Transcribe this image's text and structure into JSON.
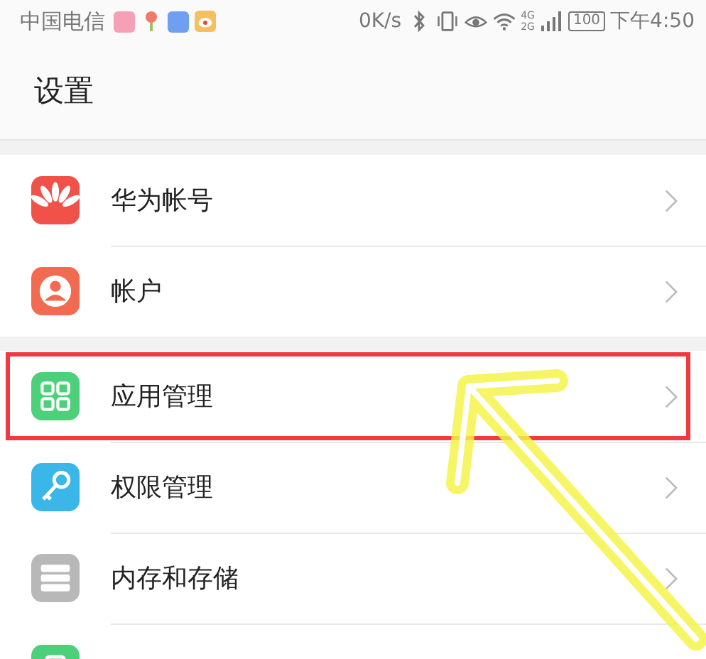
{
  "status_bar": {
    "carrier": "中国电信",
    "speed": "0K/s",
    "network_labels": [
      "4G",
      "2G"
    ],
    "battery": "100",
    "time": "下午4:50"
  },
  "title": "设置",
  "sections": [
    {
      "items": [
        {
          "label": "华为帐号",
          "color": "#f0524a",
          "highlighted": false
        },
        {
          "label": "帐户",
          "color": "#f26a4f",
          "highlighted": false
        }
      ]
    },
    {
      "items": [
        {
          "label": "应用管理",
          "color": "#4cd07a",
          "highlighted": true
        },
        {
          "label": "权限管理",
          "color": "#3bb6e8",
          "highlighted": false
        },
        {
          "label": "内存和存储",
          "color": "#b8b8b8",
          "highlighted": false
        },
        {
          "color": "#4cd07a",
          "highlighted": false
        }
      ]
    }
  ]
}
